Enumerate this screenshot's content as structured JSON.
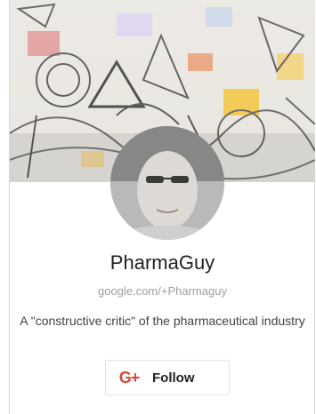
{
  "profile": {
    "name": "PharmaGuy",
    "url": "google.com/+Pharmaguy",
    "tagline": "A \"constructive critic\" of the pharmaceutical industry"
  },
  "follow_button": {
    "icon_text": "G+",
    "label": "Follow"
  },
  "icons": [
    "google-plus-icon"
  ],
  "colors": {
    "gplus_red": "#db4437",
    "name_text": "#212121",
    "url_text": "#9e9e9e"
  }
}
